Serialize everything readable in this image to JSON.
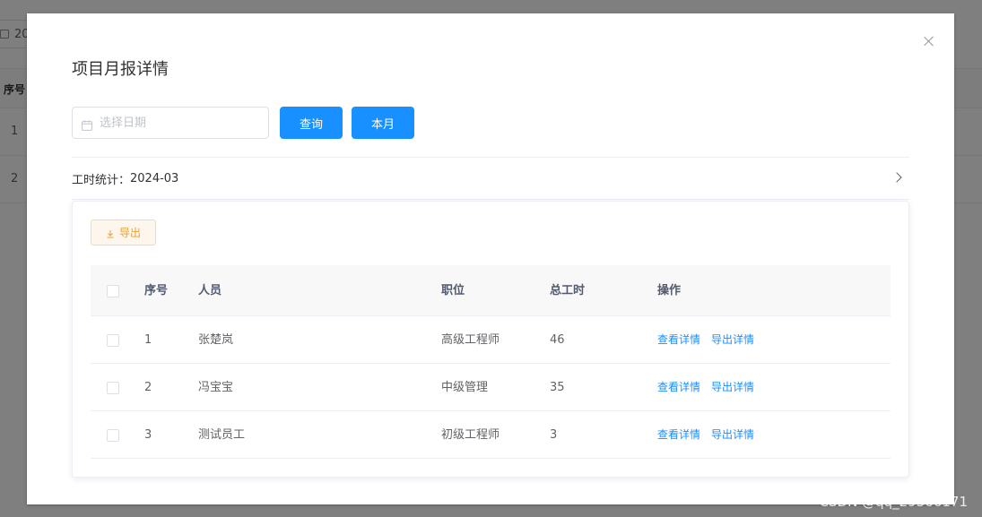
{
  "background": {
    "date_text": "20",
    "table_header_index": "序号",
    "rows": [
      "1",
      "2"
    ]
  },
  "dialog": {
    "title": "项目月报详情",
    "date_placeholder": "选择日期",
    "query_label": "查询",
    "month_label": "本月",
    "stat_label": "工时统计：",
    "stat_value": "2024-03",
    "export_label": "导出",
    "table": {
      "headers": {
        "index": "序号",
        "person": "人员",
        "position": "职位",
        "total_hours": "总工时",
        "actions": "操作"
      },
      "rows": [
        {
          "index": "1",
          "person": "张楚岚",
          "position": "高级工程师",
          "total_hours": "46",
          "view": "查看详情",
          "export": "导出详情"
        },
        {
          "index": "2",
          "person": "冯宝宝",
          "position": "中级管理",
          "total_hours": "35",
          "view": "查看详情",
          "export": "导出详情"
        },
        {
          "index": "3",
          "person": "测试员工",
          "position": "初级工程师",
          "total_hours": "3",
          "view": "查看详情",
          "export": "导出详情"
        }
      ]
    }
  },
  "watermark": "CSDN @qq_29366171",
  "colors": {
    "primary": "#1890ff",
    "warning": "#e6a23c",
    "mask": "rgba(0,0,0,0.5)"
  }
}
